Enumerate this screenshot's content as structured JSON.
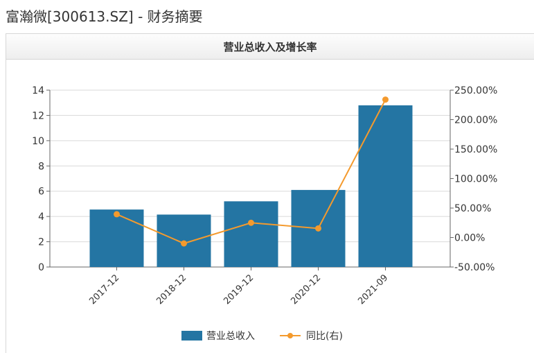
{
  "page": {
    "title": "富瀚微[300613.SZ] - 财务摘要"
  },
  "panel": {
    "title": "营业总收入及增长率"
  },
  "chart_data": {
    "type": "bar",
    "title": "营业总收入及增长率",
    "categories": [
      "2017-12",
      "2018-12",
      "2019-12",
      "2020-12",
      "2021-09"
    ],
    "series": [
      {
        "name": "营业总收入",
        "type": "bar",
        "axis": "left",
        "color": "#2475a3",
        "values": [
          4.55,
          4.15,
          5.2,
          6.1,
          12.8
        ]
      },
      {
        "name": "同比(右)",
        "type": "line",
        "axis": "right",
        "color": "#f49a2d",
        "values": [
          39.5,
          -10.0,
          25.0,
          15.5,
          234.0
        ]
      }
    ],
    "y_left": {
      "ylim": [
        0,
        14
      ],
      "ticks": [
        "0",
        "2",
        "4",
        "6",
        "8",
        "10",
        "12",
        "14"
      ]
    },
    "y_right": {
      "ylim": [
        -50,
        250
      ],
      "ticks": [
        "-50.00%",
        "0.00%",
        "50.00%",
        "100.00%",
        "150.00%",
        "200.00%",
        "250.00%"
      ]
    },
    "grid": true,
    "legend": "bottom"
  }
}
